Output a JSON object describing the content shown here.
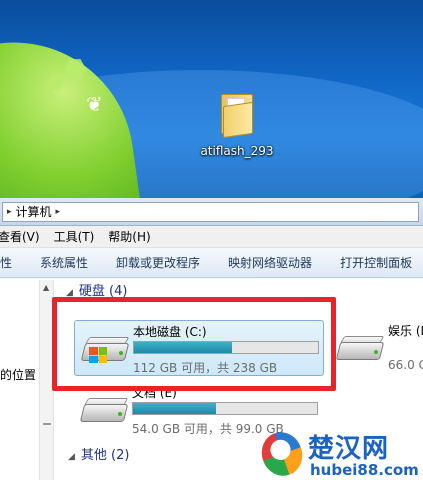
{
  "desktop": {
    "icon_label": "atiflash_293"
  },
  "address_bar": {
    "crumb": "计算机"
  },
  "menubar": {
    "items": [
      "查看(V)",
      "工具(T)",
      "帮助(H)"
    ]
  },
  "toolbar": {
    "items": [
      "性",
      "系统属性",
      "卸载或更改程序",
      "映射网络驱动器",
      "打开控制面板"
    ]
  },
  "navpane": {
    "location_label": "的位置"
  },
  "sections": {
    "hard_disks": "硬盘 (4)",
    "other": "其他 (2)"
  },
  "drives": [
    {
      "name": "本地磁盘 (C:)",
      "stats": "112 GB 可用，共 238 GB",
      "used_fraction": 0.53,
      "selected": true
    },
    {
      "name": "娱乐 (D",
      "stats": "66.0 G",
      "used_fraction": 0.5,
      "selected": false
    },
    {
      "name": "文档 (E)",
      "stats": "54.0 GB 可用，共 99.0 GB",
      "used_fraction": 0.45,
      "selected": false
    }
  ],
  "watermark": {
    "title": "楚汉网",
    "url": "hubei88.com"
  },
  "colors": {
    "highlight": "#e8242b",
    "drive_bar": "#1f8aa6",
    "section_text": "#1e3287"
  }
}
